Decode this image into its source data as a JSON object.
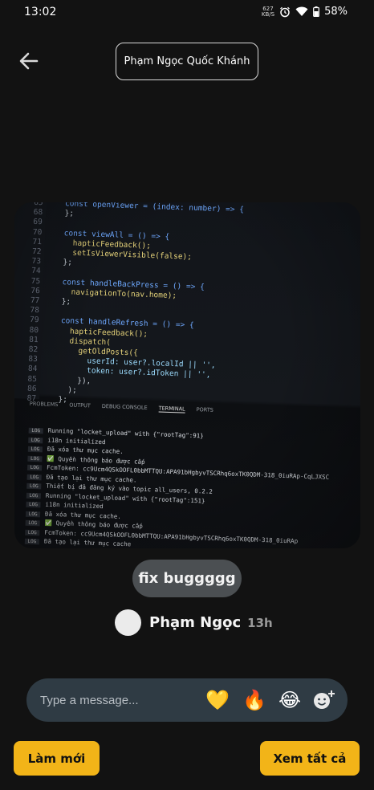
{
  "status_bar": {
    "time": "13:02",
    "net_speed_value": "627",
    "net_speed_unit": "KB/S",
    "battery": "58%",
    "icons": [
      "alarm-icon",
      "wifi-icon",
      "battery-icon"
    ]
  },
  "header": {
    "back_icon": "arrow-left-icon",
    "user_name": "Phạm Ngọc Quốc Khánh"
  },
  "photo": {
    "code_lines": [
      {
        "n": "65",
        "t": "  const openViewer = (index: number) => {"
      },
      {
        "n": "68",
        "t": "  };"
      },
      {
        "n": "69",
        "t": ""
      },
      {
        "n": "70",
        "t": "  const viewAll = () => {"
      },
      {
        "n": "71",
        "t": "    hapticFeedback();"
      },
      {
        "n": "72",
        "t": "    setIsViewerVisible(false);"
      },
      {
        "n": "73",
        "t": "  };"
      },
      {
        "n": "74",
        "t": ""
      },
      {
        "n": "75",
        "t": "  const handleBackPress = () => {"
      },
      {
        "n": "76",
        "t": "    navigationTo(nav.home);"
      },
      {
        "n": "77",
        "t": "  };"
      },
      {
        "n": "78",
        "t": ""
      },
      {
        "n": "79",
        "t": "  const handleRefresh = () => {"
      },
      {
        "n": "80",
        "t": "    hapticFeedback();"
      },
      {
        "n": "81",
        "t": "    dispatch("
      },
      {
        "n": "82",
        "t": "      getOldPosts({"
      },
      {
        "n": "83",
        "t": "        userId: user?.localId || '',"
      },
      {
        "n": "84",
        "t": "        token: user?.idToken || '',"
      },
      {
        "n": "85",
        "t": "      }),"
      },
      {
        "n": "86",
        "t": "    );"
      },
      {
        "n": "87",
        "t": "  };"
      }
    ],
    "panel_tabs": [
      "PROBLEMS",
      "OUTPUT",
      "DEBUG CONSOLE",
      "TERMINAL",
      "PORTS"
    ],
    "terminal_lines": [
      "Running \"locket_upload\" with {\"rootTag\":91}",
      "i18n initialized",
      "Đã xóa thư mục cache.",
      "✅ Quyền thông báo được cấp",
      "FcmToken: cc9Ucm4QSkOOFL0bbMTTQU:APA91bHgbyvTSCRhq6oxTK0QDM-318_0iuRAp-CqLJXSC",
      "Đã tạo lại thư mục cache.",
      "Thiết bị đã đăng ký vào topic all_users, 0.2.2",
      "Running \"locket_upload\" with {\"rootTag\":151}",
      "i18n initialized",
      "Đã xóa thư mục cache.",
      "✅ Quyền thông báo được cấp",
      "FcmToken: cc9Ucm4QSkOOFL0bbMTTQU:APA91bHgbyvTSCRhq6oxTK0QDM-318_0iuRAp",
      "Đã tạo lại thư mục cache"
    ],
    "log_badge": "LOG"
  },
  "caption": "fix buggggg",
  "sender": {
    "name": "Phạm Ngọc",
    "time": "13h"
  },
  "message_bar": {
    "placeholder": "Type a message...",
    "reactions": [
      "💛",
      "🔥",
      "😂"
    ],
    "add_reaction_icon": "add-emoji-icon"
  },
  "buttons": {
    "refresh_label": "Làm mới",
    "view_all_label": "Xem tất cả"
  },
  "colors": {
    "background": "#121212",
    "accent": "#f2b418",
    "message_bar": "#2f3b44",
    "caption_pill": "#4b4f52"
  }
}
